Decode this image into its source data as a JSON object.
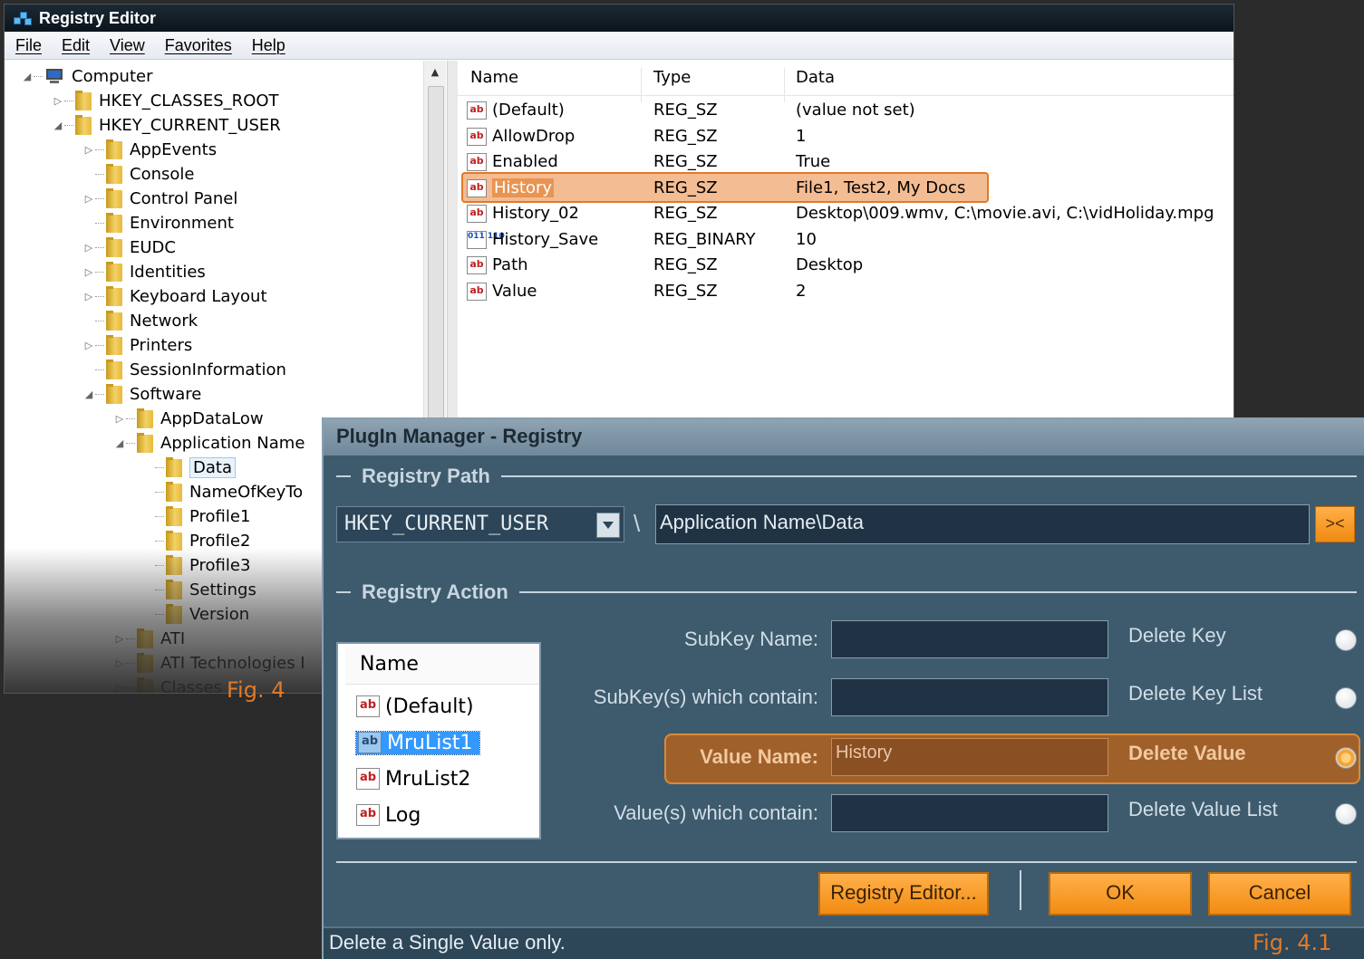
{
  "regedit": {
    "title": "Registry Editor",
    "menu": [
      "File",
      "Edit",
      "View",
      "Favorites",
      "Help"
    ],
    "tree": [
      {
        "label": "Computer",
        "level": 0,
        "arrow": "◢",
        "icon": "computer"
      },
      {
        "label": "HKEY_CLASSES_ROOT",
        "level": 1,
        "arrow": "▷"
      },
      {
        "label": "HKEY_CURRENT_USER",
        "level": 1,
        "arrow": "◢"
      },
      {
        "label": "AppEvents",
        "level": 2,
        "arrow": "▷"
      },
      {
        "label": "Console",
        "level": 2,
        "arrow": ""
      },
      {
        "label": "Control Panel",
        "level": 2,
        "arrow": "▷"
      },
      {
        "label": "Environment",
        "level": 2,
        "arrow": ""
      },
      {
        "label": "EUDC",
        "level": 2,
        "arrow": "▷"
      },
      {
        "label": "Identities",
        "level": 2,
        "arrow": "▷"
      },
      {
        "label": "Keyboard Layout",
        "level": 2,
        "arrow": "▷"
      },
      {
        "label": "Network",
        "level": 2,
        "arrow": ""
      },
      {
        "label": "Printers",
        "level": 2,
        "arrow": "▷"
      },
      {
        "label": "SessionInformation",
        "level": 2,
        "arrow": ""
      },
      {
        "label": "Software",
        "level": 2,
        "arrow": "◢"
      },
      {
        "label": "AppDataLow",
        "level": 3,
        "arrow": "▷"
      },
      {
        "label": "Application Name",
        "level": 3,
        "arrow": "◢"
      },
      {
        "label": "Data",
        "level": 4,
        "arrow": "",
        "selected": true
      },
      {
        "label": "NameOfKeyTo",
        "level": 4,
        "arrow": ""
      },
      {
        "label": "Profile1",
        "level": 4,
        "arrow": ""
      },
      {
        "label": "Profile2",
        "level": 4,
        "arrow": ""
      },
      {
        "label": "Profile3",
        "level": 4,
        "arrow": ""
      },
      {
        "label": "Settings",
        "level": 4,
        "arrow": ""
      },
      {
        "label": "Version",
        "level": 4,
        "arrow": ""
      },
      {
        "label": "ATI",
        "level": 3,
        "arrow": "▷"
      },
      {
        "label": "ATI Technologies I",
        "level": 3,
        "arrow": "▷"
      },
      {
        "label": "Classes",
        "level": 3,
        "arrow": "▷"
      }
    ],
    "columns": {
      "name": "Name",
      "type": "Type",
      "data": "Data"
    },
    "values": [
      {
        "name": "(Default)",
        "type": "REG_SZ",
        "data": "(value not set)",
        "icon": "ab"
      },
      {
        "name": "AllowDrop",
        "type": "REG_SZ",
        "data": "1",
        "icon": "ab"
      },
      {
        "name": "Enabled",
        "type": "REG_SZ",
        "data": "True",
        "icon": "ab"
      },
      {
        "name": "History",
        "type": "REG_SZ",
        "data": "File1, Test2, My Docs",
        "icon": "ab",
        "highlighted": true
      },
      {
        "name": "History_02",
        "type": "REG_SZ",
        "data": "Desktop\\009.wmv, C:\\movie.avi, C:\\vidHoliday.mpg",
        "icon": "ab"
      },
      {
        "name": "History_Save",
        "type": "REG_BINARY",
        "data": "10",
        "icon": "bin"
      },
      {
        "name": "Path",
        "type": "REG_SZ",
        "data": "Desktop",
        "icon": "ab"
      },
      {
        "name": "Value",
        "type": "REG_SZ",
        "data": "2",
        "icon": "ab"
      }
    ],
    "icon_text": {
      "string": "ab",
      "binary": "011 110"
    }
  },
  "plugin": {
    "title": "PlugIn Manager - Registry",
    "path_section": "Registry Path",
    "hive": "HKEY_CURRENT_USER",
    "separator": "\\",
    "path": "Application Name\\Data",
    "go_label": "><",
    "action_section": "Registry Action",
    "list_header": "Name",
    "list_items": [
      {
        "label": "(Default)",
        "selected": false
      },
      {
        "label": "MruList1",
        "selected": true
      },
      {
        "label": "MruList2",
        "selected": false
      },
      {
        "label": "Log",
        "selected": false
      }
    ],
    "rows": [
      {
        "label": "SubKey Name:",
        "value": "",
        "option": "Delete Key",
        "selected": false
      },
      {
        "label": "SubKey(s) which contain:",
        "value": "",
        "option": "Delete Key List",
        "selected": false
      },
      {
        "label": "Value Name:",
        "value": "History",
        "option": "Delete Value",
        "selected": true
      },
      {
        "label": "Value(s) which contain:",
        "value": "",
        "option": "Delete Value List",
        "selected": false
      }
    ],
    "buttons": {
      "registry_editor": "Registry Editor...",
      "ok": "OK",
      "cancel": "Cancel"
    },
    "status": "Delete a Single Value only."
  },
  "captions": {
    "fig4": "Fig. 4",
    "fig41": "Fig. 4.1"
  },
  "colors": {
    "accent": "#e07a2a",
    "plugin_bg": "#3e5b6e",
    "button": "#f28c12"
  }
}
